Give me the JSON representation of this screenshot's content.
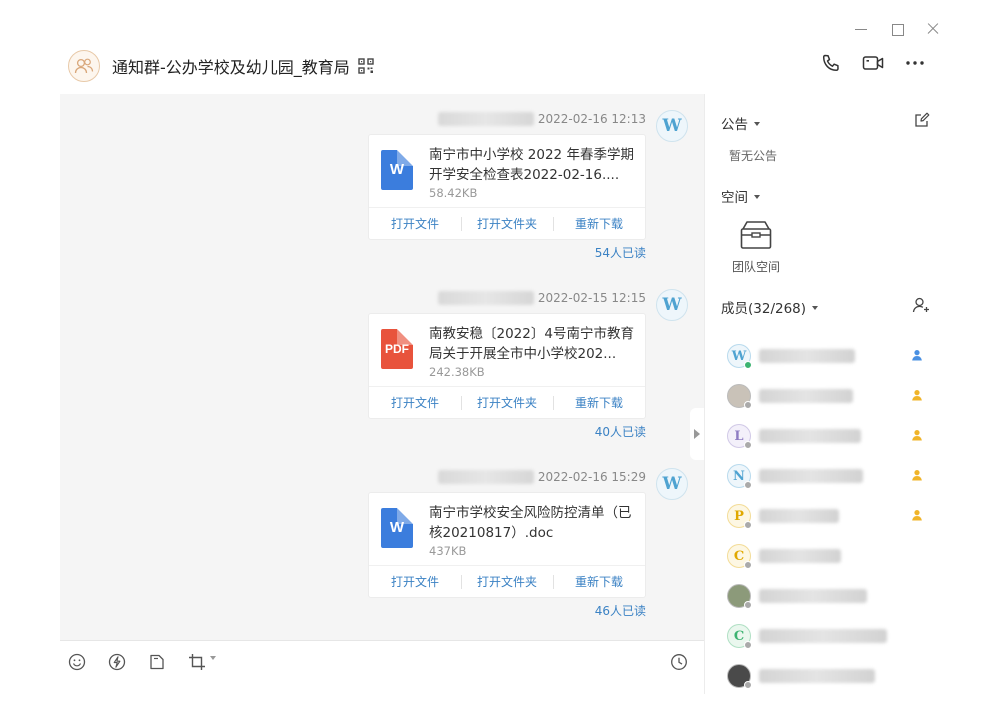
{
  "window": {
    "title": "通知群-公办学校及幼儿园_教育局"
  },
  "messages": [
    {
      "time": "2022-02-16 12:13",
      "sender_initial": "W",
      "file_type": "W",
      "file_name": "南宁市中小学校 2022 年春季学期开学安全检查表2022-02-16....",
      "file_size": "58.42KB",
      "actions": [
        "打开文件",
        "打开文件夹",
        "重新下载"
      ],
      "read_count": "54人已读"
    },
    {
      "time": "2022-02-15 12:15",
      "sender_initial": "W",
      "file_type": "PDF",
      "file_name": "南教安稳〔2022〕4号南宁市教育局关于开展全市中小学校202...",
      "file_size": "242.38KB",
      "actions": [
        "打开文件",
        "打开文件夹",
        "重新下载"
      ],
      "read_count": "40人已读"
    },
    {
      "time": "2022-02-16 15:29",
      "sender_initial": "W",
      "file_type": "W",
      "file_name": "南宁市学校安全风险防控清单（已核20210817）.doc",
      "file_size": "437KB",
      "actions": [
        "打开文件",
        "打开文件夹",
        "重新下载"
      ],
      "read_count": "46人已读"
    }
  ],
  "side": {
    "notice_label": "公告",
    "notice_empty": "暂无公告",
    "space_label": "空间",
    "team_space": "团队空间",
    "members_label": "成员(32/268)",
    "members": [
      {
        "initial": "W",
        "color": "#4fa3d1",
        "bg": "#eef6fb",
        "status": "#3cb371",
        "role": "#4a90e2"
      },
      {
        "initial": "",
        "color": "#777",
        "bg": "#c9c2b8",
        "status": "#aaaaaa",
        "role": "#f0b429"
      },
      {
        "initial": "L",
        "color": "#8e7cc3",
        "bg": "#f3f0fa",
        "status": "#aaaaaa",
        "role": "#f0b429"
      },
      {
        "initial": "N",
        "color": "#4fa3d1",
        "bg": "#eef6fb",
        "status": "#aaaaaa",
        "role": "#f0b429"
      },
      {
        "initial": "P",
        "color": "#e0a800",
        "bg": "#fdf7e3",
        "status": "#aaaaaa",
        "role": "#f0b429"
      },
      {
        "initial": "C",
        "color": "#e0a800",
        "bg": "#fdf7e3",
        "status": "#aaaaaa",
        "role": ""
      },
      {
        "initial": "",
        "color": "#777",
        "bg": "#8c9a7a",
        "status": "#aaaaaa",
        "role": ""
      },
      {
        "initial": "C",
        "color": "#3cb371",
        "bg": "#eaf7ee",
        "status": "#aaaaaa",
        "role": ""
      },
      {
        "initial": "",
        "color": "#777",
        "bg": "#4a4a4a",
        "status": "#aaaaaa",
        "role": ""
      }
    ]
  },
  "colors": {
    "accent": "#3b82c4",
    "doc_icon": "#3b7ddd",
    "pdf_icon": "#e8533c"
  }
}
